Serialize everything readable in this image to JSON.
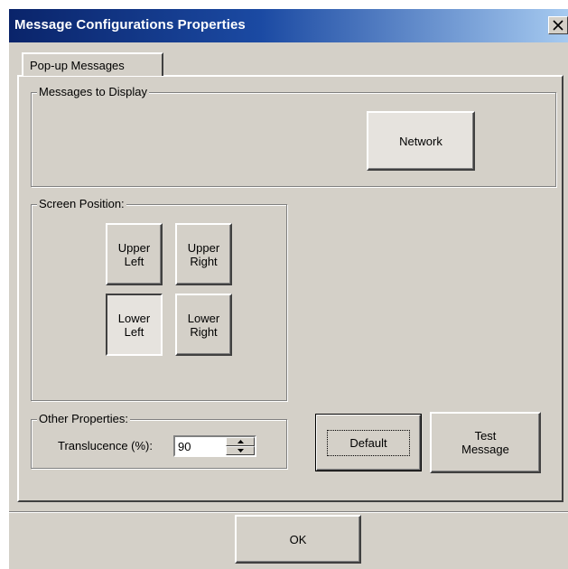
{
  "window": {
    "title": "Message Configurations Properties"
  },
  "tabs": [
    {
      "label": "Pop-up Messages",
      "active": true
    }
  ],
  "messages_group": {
    "legend": "Messages to Display",
    "network_button": "Network"
  },
  "position_group": {
    "legend": "Screen Position:",
    "upper_left": "Upper\nLeft",
    "upper_right": "Upper\nRight",
    "lower_left": "Lower\nLeft",
    "lower_right": "Lower\nRight",
    "selected": "Lower Left"
  },
  "other_group": {
    "legend": "Other Properties:",
    "translucence_label": "Translucence (%):",
    "translucence_value": "90"
  },
  "actions": {
    "default_label": "Default",
    "test_label": "Test\nMessage",
    "ok_label": "OK"
  },
  "colors": {
    "face": "#d4d0c8",
    "title_start": "#0a246a",
    "title_end": "#a6caf0"
  }
}
